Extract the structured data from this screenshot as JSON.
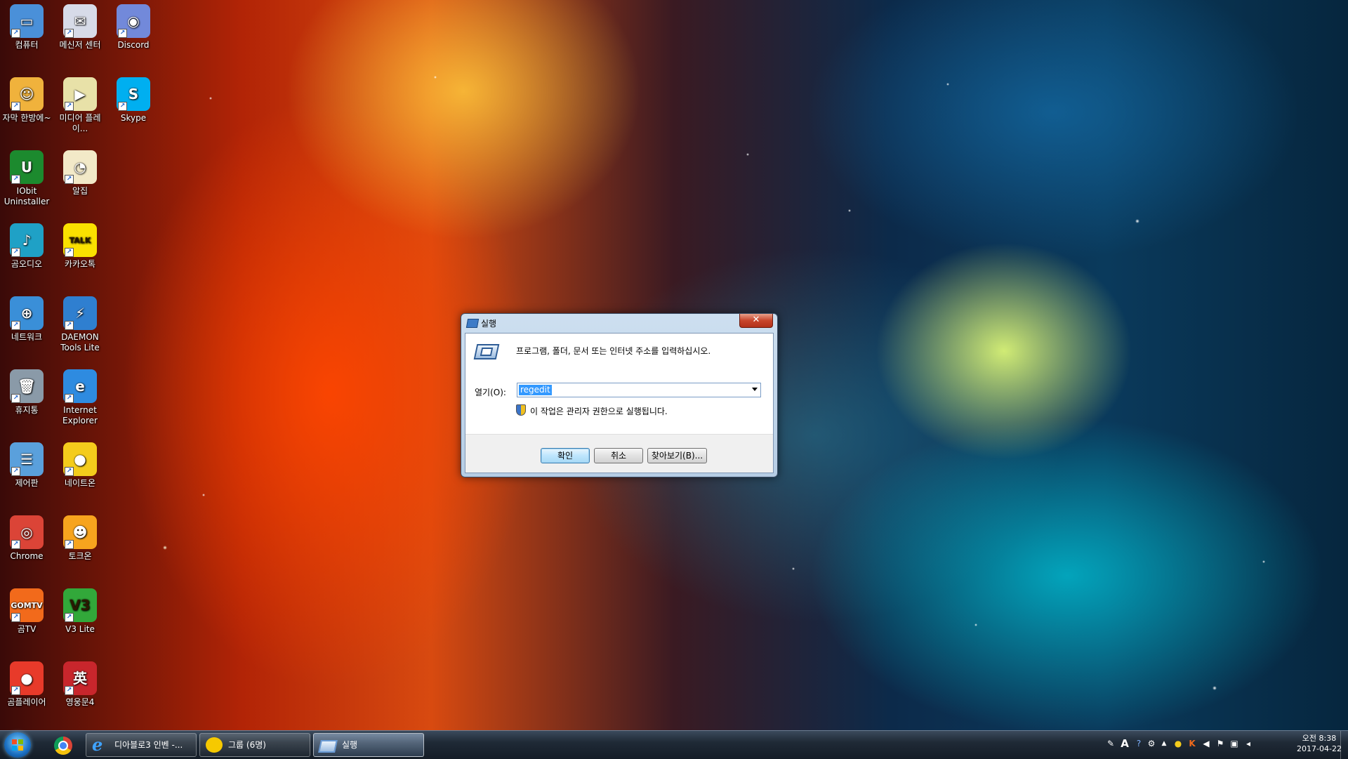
{
  "desktop_icons": [
    {
      "label": "컴퓨터",
      "icon": "computer-icon",
      "color": "#4a90d9",
      "glyph": "▭"
    },
    {
      "label": "메신저 센터",
      "icon": "messenger-center-icon",
      "color": "#d7dbe8",
      "glyph": "✉"
    },
    {
      "label": "Discord",
      "icon": "discord-icon",
      "color": "#7289da",
      "glyph": "◉"
    },
    {
      "label": "자막 한방에~",
      "icon": "subtitle-tool-icon",
      "color": "#f0b23c",
      "glyph": "☺"
    },
    {
      "label": "미디어 플레이...",
      "icon": "media-player-icon",
      "color": "#e8e1a8",
      "glyph": "▶"
    },
    {
      "label": "Skype",
      "icon": "skype-icon",
      "color": "#00aff0",
      "glyph": "S"
    },
    {
      "label": "IObit Uninstaller",
      "icon": "iobit-uninstaller-icon",
      "color": "#1c8a2e",
      "glyph": "U"
    },
    {
      "label": "알집",
      "icon": "alzip-icon",
      "color": "#f2e9c8",
      "glyph": "◔"
    },
    {
      "label": "곰오디오",
      "icon": "gom-audio-icon",
      "color": "#1fa1c6",
      "glyph": "♪"
    },
    {
      "label": "카카오톡",
      "icon": "kakaotalk-icon",
      "color": "#fae100",
      "glyph": "TALK"
    },
    {
      "label": "네트워크",
      "icon": "network-icon",
      "color": "#3a8fd8",
      "glyph": "⊕"
    },
    {
      "label": "DAEMON Tools Lite",
      "icon": "daemon-tools-icon",
      "color": "#2f7fd0",
      "glyph": "⚡"
    },
    {
      "label": "휴지통",
      "icon": "recycle-bin-icon",
      "color": "#8a9aa8",
      "glyph": "🗑"
    },
    {
      "label": "Internet Explorer",
      "icon": "internet-explorer-icon",
      "color": "#2e8be0",
      "glyph": "e"
    },
    {
      "label": "제어판",
      "icon": "control-panel-icon",
      "color": "#5aa0dc",
      "glyph": "☰"
    },
    {
      "label": "네이트온",
      "icon": "nateon-icon",
      "color": "#f4cc1c",
      "glyph": "●"
    },
    {
      "label": "Chrome",
      "icon": "chrome-icon",
      "color": "#db4437",
      "glyph": "◎"
    },
    {
      "label": "토크온",
      "icon": "talkon-icon",
      "color": "#f7a41e",
      "glyph": "☻"
    },
    {
      "label": "곰TV",
      "icon": "gomtv-icon",
      "color": "#f26a1b",
      "glyph": "GOMTV"
    },
    {
      "label": "V3 Lite",
      "icon": "v3-lite-icon",
      "color": "#32a83a",
      "glyph": "V3"
    },
    {
      "label": "곰플레이어",
      "icon": "gom-player-icon",
      "color": "#e83a2a",
      "glyph": "●"
    },
    {
      "label": "영웅문4",
      "icon": "youngwoongmun-icon",
      "color": "#c8262c",
      "glyph": "英"
    }
  ],
  "run_dialog": {
    "title": "실행",
    "close_label": "✕",
    "prompt": "프로그램, 폴더, 문서 또는 인터넷 주소를 입력하십시오.",
    "open_label": "열기(O):",
    "open_value": "regedit",
    "admin_note": "이 작업은 관리자 권한으로 실행됩니다.",
    "ok_label": "확인",
    "cancel_label": "취소",
    "browse_label": "찾아보기(B)..."
  },
  "taskbar": {
    "tasks": [
      {
        "label": "디아블로3 인벤 -...",
        "icon": "internet-explorer-icon"
      },
      {
        "label": "그룹 (6명)",
        "icon": "chat-bubble-icon"
      },
      {
        "label": "실행",
        "icon": "run-icon"
      }
    ],
    "clock_time": "오전 8:38",
    "clock_date": "2017-04-22"
  }
}
